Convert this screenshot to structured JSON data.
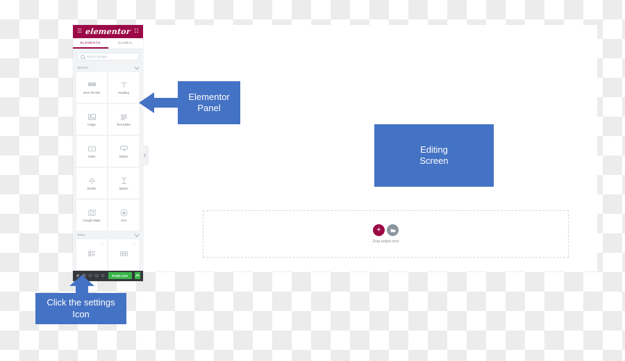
{
  "app": {
    "canvas_background": "#ffffff",
    "accent_color": "#9b0a46",
    "publish_color": "#39b54a",
    "callout_color": "#4472c4"
  },
  "panel": {
    "logo": "elementor",
    "menu_icon": "hamburger-icon",
    "grid_icon": "grid-icon",
    "tabs": [
      {
        "label": "ELEMENTS",
        "active": true
      },
      {
        "label": "GLOBAL",
        "active": false
      }
    ],
    "search": {
      "placeholder": "Search Widget...",
      "value": ""
    },
    "categories": [
      {
        "name": "BASIC",
        "expanded": true,
        "widgets": [
          {
            "label": "Inner Section",
            "icon": "columns-icon",
            "locked": false
          },
          {
            "label": "Heading",
            "icon": "heading-t-icon",
            "locked": false
          },
          {
            "label": "Image",
            "icon": "image-icon",
            "locked": false
          },
          {
            "label": "Text Editor",
            "icon": "text-lines-icon",
            "locked": false
          },
          {
            "label": "Video",
            "icon": "video-play-icon",
            "locked": false
          },
          {
            "label": "Button",
            "icon": "button-cursor-icon",
            "locked": false
          },
          {
            "label": "Divider",
            "icon": "divider-icon",
            "locked": false
          },
          {
            "label": "Spacer",
            "icon": "spacer-icon",
            "locked": false
          },
          {
            "label": "Google Maps",
            "icon": "map-icon",
            "locked": false
          },
          {
            "label": "Icon",
            "icon": "star-badge-icon",
            "locked": false
          }
        ]
      },
      {
        "name": "PRO",
        "expanded": true,
        "widgets": [
          {
            "label": "",
            "icon": "posts-list-icon",
            "locked": true
          },
          {
            "label": "",
            "icon": "grid-gallery-icon",
            "locked": true
          }
        ]
      }
    ],
    "footer": {
      "icons": [
        "settings-gear-icon",
        "navigator-icon",
        "history-icon",
        "responsive-mode-icon",
        "preview-eye-icon"
      ],
      "publish_label": "PUBLISH",
      "publish_caret": "chevron-up-icon"
    },
    "collapse_handle": "panel-collapse-handle"
  },
  "editor": {
    "drop_area": {
      "add_section_label": "+",
      "add_template_icon": "folder-icon",
      "hint": "Drag widget here"
    }
  },
  "annotations": [
    {
      "id": "elementor-panel",
      "line1": "Elementor",
      "line2": "Panel",
      "arrow": "arrow-left"
    },
    {
      "id": "editing-screen",
      "line1": "Editing",
      "line2": "Screen",
      "arrow": "none"
    },
    {
      "id": "settings-icon",
      "line1": "Click the settings",
      "line2": "Icon",
      "arrow": "arrow-up"
    }
  ]
}
